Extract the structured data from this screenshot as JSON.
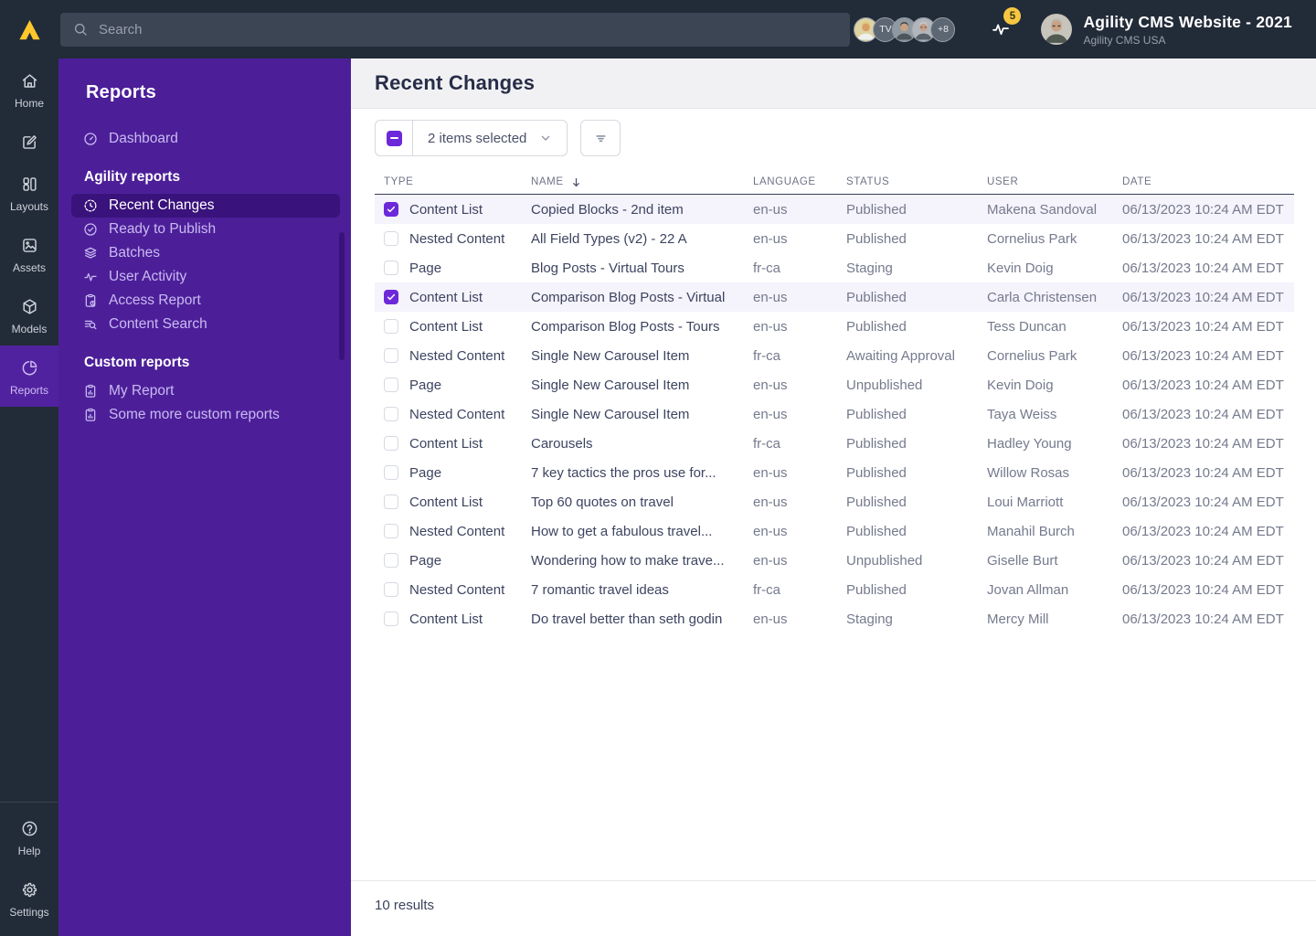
{
  "colors": {
    "topbar_bg": "#222b38",
    "sidebar_purple": "#4c1f99",
    "sidebar_active_purple": "#39127b",
    "accent_purple": "#6d28d9",
    "brand_yellow": "#ffc72c",
    "selected_row_bg": "#f5f3fb"
  },
  "topbar": {
    "search_placeholder": "Search",
    "avatars": [
      {
        "kind": "photo",
        "variant": "a"
      },
      {
        "kind": "initials",
        "label": "TV"
      },
      {
        "kind": "photo",
        "variant": "b"
      },
      {
        "kind": "photo",
        "variant": "c"
      },
      {
        "kind": "initials",
        "label": "+8"
      }
    ],
    "notification_count": "5",
    "user_avatar": {
      "kind": "photo",
      "variant": "user"
    },
    "instance_title": "Agility CMS Website - 2021",
    "instance_subtitle": "Agility CMS USA"
  },
  "rail": {
    "items": [
      {
        "name": "home",
        "icon": "home-icon",
        "label": "Home",
        "active": false
      },
      {
        "name": "compose",
        "icon": "compose-icon",
        "label": "",
        "active": false
      },
      {
        "name": "layouts",
        "icon": "layouts-icon",
        "label": "Layouts",
        "active": false
      },
      {
        "name": "assets",
        "icon": "assets-icon",
        "label": "Assets",
        "active": false
      },
      {
        "name": "models",
        "icon": "models-icon",
        "label": "Models",
        "active": false
      },
      {
        "name": "reports",
        "icon": "reports-icon",
        "label": "Reports",
        "active": true
      }
    ],
    "bottom_items": [
      {
        "name": "help",
        "icon": "help-icon",
        "label": "Help",
        "active": false
      },
      {
        "name": "settings",
        "icon": "settings-icon",
        "label": "Settings",
        "active": false
      }
    ]
  },
  "sidebar": {
    "title": "Reports",
    "entries": [
      {
        "kind": "item",
        "icon": "dashboard-icon",
        "label": "Dashboard",
        "active": false
      },
      {
        "kind": "heading",
        "label": "Agility reports"
      },
      {
        "kind": "item",
        "icon": "history-icon",
        "label": "Recent Changes",
        "active": true
      },
      {
        "kind": "item",
        "icon": "check-circle-icon",
        "label": "Ready to Publish",
        "active": false
      },
      {
        "kind": "item",
        "icon": "layers-icon",
        "label": "Batches",
        "active": false
      },
      {
        "kind": "item",
        "icon": "activity-icon",
        "label": "User Activity",
        "active": false
      },
      {
        "kind": "item",
        "icon": "clipboard-clock-icon",
        "label": "Access Report",
        "active": false
      },
      {
        "kind": "item",
        "icon": "content-search-icon",
        "label": "Content Search",
        "active": false
      },
      {
        "kind": "heading",
        "label": "Custom reports"
      },
      {
        "kind": "item",
        "icon": "clipboard-chart-icon",
        "label": "My Report",
        "active": false
      },
      {
        "kind": "item",
        "icon": "clipboard-chart-icon",
        "label": "Some more custom reports",
        "active": false
      }
    ]
  },
  "main": {
    "title": "Recent Changes",
    "toolbar": {
      "selection_label": "2 items selected"
    },
    "table": {
      "columns": [
        "TYPE",
        "NAME",
        "LANGUAGE",
        "STATUS",
        "USER",
        "DATE"
      ],
      "sorted_column": "NAME",
      "rows": [
        {
          "selected": true,
          "type": "Content List",
          "name": "Copied Blocks - 2nd item",
          "language": "en-us",
          "status": "Published",
          "user": "Makena Sandoval",
          "date": "06/13/2023 10:24 AM EDT"
        },
        {
          "selected": false,
          "type": "Nested Content",
          "name": "All Field Types (v2) - 22 A",
          "language": "en-us",
          "status": "Published",
          "user": "Cornelius Park",
          "date": "06/13/2023 10:24 AM EDT"
        },
        {
          "selected": false,
          "type": "Page",
          "name": "Blog Posts - Virtual Tours",
          "language": "fr-ca",
          "status": "Staging",
          "user": "Kevin Doig",
          "date": "06/13/2023 10:24 AM EDT"
        },
        {
          "selected": true,
          "type": "Content List",
          "name": "Comparison Blog Posts - Virtual",
          "language": "en-us",
          "status": "Published",
          "user": "Carla Christensen",
          "date": "06/13/2023 10:24 AM EDT"
        },
        {
          "selected": false,
          "type": "Content List",
          "name": "Comparison Blog Posts - Tours",
          "language": "en-us",
          "status": "Published",
          "user": "Tess Duncan",
          "date": "06/13/2023 10:24 AM EDT"
        },
        {
          "selected": false,
          "type": "Nested Content",
          "name": "Single New Carousel Item",
          "language": "fr-ca",
          "status": "Awaiting Approval",
          "user": "Cornelius Park",
          "date": "06/13/2023 10:24 AM EDT"
        },
        {
          "selected": false,
          "type": "Page",
          "name": "Single New Carousel Item",
          "language": "en-us",
          "status": "Unpublished",
          "user": "Kevin Doig",
          "date": "06/13/2023 10:24 AM EDT"
        },
        {
          "selected": false,
          "type": "Nested Content",
          "name": "Single New Carousel Item",
          "language": "en-us",
          "status": "Published",
          "user": "Taya Weiss",
          "date": "06/13/2023 10:24 AM EDT"
        },
        {
          "selected": false,
          "type": "Content List",
          "name": "Carousels",
          "language": "fr-ca",
          "status": "Published",
          "user": "Hadley Young",
          "date": "06/13/2023 10:24 AM EDT"
        },
        {
          "selected": false,
          "type": "Page",
          "name": "7 key tactics the pros use for...",
          "language": "en-us",
          "status": "Published",
          "user": "Willow Rosas",
          "date": "06/13/2023 10:24 AM EDT"
        },
        {
          "selected": false,
          "type": "Content List",
          "name": "Top 60 quotes on travel",
          "language": "en-us",
          "status": "Published",
          "user": "Loui Marriott",
          "date": "06/13/2023 10:24 AM EDT"
        },
        {
          "selected": false,
          "type": "Nested Content",
          "name": "How to get a fabulous travel...",
          "language": "en-us",
          "status": "Published",
          "user": "Manahil Burch",
          "date": "06/13/2023 10:24 AM EDT"
        },
        {
          "selected": false,
          "type": "Page",
          "name": "Wondering how to make trave...",
          "language": "en-us",
          "status": "Unpublished",
          "user": "Giselle Burt",
          "date": "06/13/2023 10:24 AM EDT"
        },
        {
          "selected": false,
          "type": "Nested Content",
          "name": "7 romantic travel ideas",
          "language": "fr-ca",
          "status": "Published",
          "user": "Jovan Allman",
          "date": "06/13/2023 10:24 AM EDT"
        },
        {
          "selected": false,
          "type": "Content List",
          "name": "Do travel better than seth godin",
          "language": "en-us",
          "status": "Staging",
          "user": "Mercy Mill",
          "date": "06/13/2023 10:24 AM EDT"
        }
      ]
    },
    "footer": {
      "results_label": "10 results"
    }
  }
}
